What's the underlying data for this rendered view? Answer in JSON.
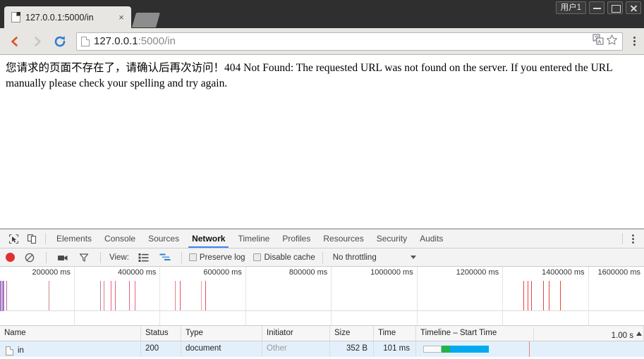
{
  "window": {
    "user_chip_label": "用户1",
    "minimize_label": "Minimize",
    "maximize_label": "Maximize",
    "close_label": "Close"
  },
  "tabs": [
    {
      "title": "127.0.0.1:5000/in",
      "favicon": "page-icon",
      "close_glyph": "×"
    }
  ],
  "navbar": {
    "back_glyph": "❮",
    "forward_glyph": "❯",
    "reload_glyph": "↻",
    "url_main": "127.0.0.1",
    "url_rest": ":5000/in",
    "translate_icon": "translate-icon",
    "bookmark_glyph": "☆"
  },
  "page": {
    "body_text": "您请求的页面不存在了，请确认后再次访问！404 Not Found: The requested URL was not found on the server. If you entered the URL manually please check your spelling and try again."
  },
  "devtools": {
    "tabs": [
      {
        "label": "Elements",
        "active": false
      },
      {
        "label": "Console",
        "active": false
      },
      {
        "label": "Sources",
        "active": false
      },
      {
        "label": "Network",
        "active": true
      },
      {
        "label": "Timeline",
        "active": false
      },
      {
        "label": "Profiles",
        "active": false
      },
      {
        "label": "Resources",
        "active": false
      },
      {
        "label": "Security",
        "active": false
      },
      {
        "label": "Audits",
        "active": false
      }
    ],
    "inspect_icon": "inspect-element-icon",
    "device_icon": "device-toolbar-icon",
    "more_icon": "more-options-icon",
    "network_toolbar": {
      "record_label": "Record",
      "clear_label": "Clear",
      "capture_screenshots_label": "Capture screenshots",
      "filter_label": "Filter",
      "view_label": "View:",
      "view_list_icon": "list-view-icon",
      "view_waterfall_icon": "waterfall-view-icon",
      "preserve_log_label": "Preserve log",
      "preserve_log_checked": false,
      "disable_cache_label": "Disable cache",
      "disable_cache_checked": false,
      "throttling_value": "No throttling"
    },
    "overview": {
      "tick_labels": [
        "200000 ms",
        "400000 ms",
        "600000 ms",
        "800000 ms",
        "1000000 ms",
        "1200000 ms",
        "1400000 ms",
        "1600000 ms"
      ],
      "tick_positions_pct": [
        11.5,
        24.8,
        38.1,
        51.4,
        64.7,
        78.0,
        91.3,
        100.0
      ],
      "event_color_primary": "#e8443f",
      "event_color_secondary": "#eb7f9e",
      "event_lines_pct": [
        {
          "x": 0.6,
          "color": "#c87fb0"
        },
        {
          "x": 1.0,
          "color": "#b06ea8"
        },
        {
          "x": 7.6,
          "color": "#c08a86"
        },
        {
          "x": 15.5,
          "color": "#b08a9c"
        },
        {
          "x": 16.1,
          "color": "#d97f90"
        },
        {
          "x": 17.2,
          "color": "#ee5f7b"
        },
        {
          "x": 17.9,
          "color": "#ee5f7b"
        },
        {
          "x": 20.0,
          "color": "#ee5f7b"
        },
        {
          "x": 20.9,
          "color": "#ee5f7b"
        },
        {
          "x": 27.2,
          "color": "#e8807f"
        },
        {
          "x": 27.9,
          "color": "#ea4d62"
        },
        {
          "x": 31.2,
          "color": "#efa0a0"
        },
        {
          "x": 31.9,
          "color": "#ea4d62"
        },
        {
          "x": 81.3,
          "color": "#e8443f"
        },
        {
          "x": 81.9,
          "color": "#e8443f"
        },
        {
          "x": 82.5,
          "color": "#e8443f"
        },
        {
          "x": 84.3,
          "color": "#e8443f"
        },
        {
          "x": 85.2,
          "color": "#e8443f"
        },
        {
          "x": 87.0,
          "color": "#e8443f"
        }
      ],
      "selection_label": "overview-selection-handle"
    },
    "table": {
      "columns": [
        "Name",
        "Status",
        "Type",
        "Initiator",
        "Size",
        "Time",
        "Timeline – Start Time"
      ],
      "timeline_scale": "1.00 s",
      "rows": [
        {
          "name": "in",
          "status": "200",
          "type": "document",
          "initiator": "Other",
          "size": "352 B",
          "time": "101 ms",
          "waterfall": {
            "queue_left_pct": 3,
            "queue_width_pct": 8,
            "green_left_pct": 11,
            "green_width_pct": 4,
            "blue_left_pct": 15,
            "blue_width_pct": 17
          }
        }
      ]
    }
  }
}
